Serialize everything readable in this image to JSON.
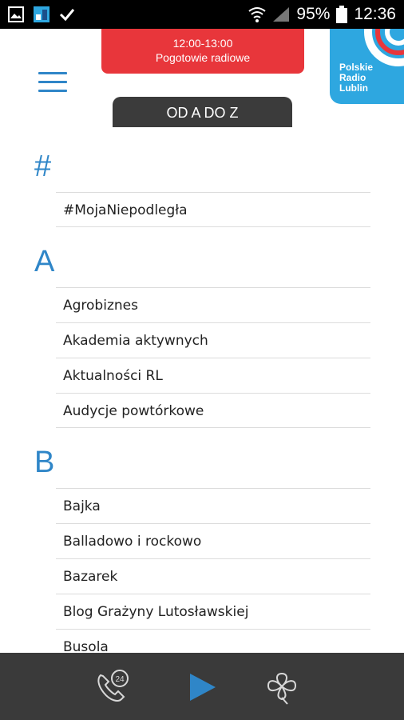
{
  "status_bar": {
    "battery_percent": "95%",
    "time": "12:36",
    "icons": [
      "image-icon",
      "app-icon",
      "check-icon",
      "wifi-icon",
      "signal-icon",
      "battery-icon"
    ]
  },
  "header": {
    "now_playing_time": "12:00-13:00",
    "now_playing_title": "Pogotowie radiowe",
    "logo": [
      "Polskie",
      "Radio",
      "Lublin"
    ],
    "tab_label": "OD A DO Z",
    "colors": {
      "accent": "#2f86c8",
      "red": "#e8363b",
      "logo_blue": "#2ea7e0"
    }
  },
  "sections": [
    {
      "letter": "#",
      "items": [
        "#MojaNiepodległa"
      ]
    },
    {
      "letter": "A",
      "items": [
        "Agrobiznes",
        "Akademia aktywnych",
        "Aktualności RL",
        "Audycje powtórkowe"
      ]
    },
    {
      "letter": "B",
      "items": [
        "Bajka",
        "Balladowo i rockowo",
        "Bazarek",
        "Blog Grażyny Lutosławskiej",
        "Busola"
      ]
    }
  ],
  "player": {
    "buttons": [
      "phone-24-icon",
      "play-icon",
      "clover-icon"
    ]
  }
}
